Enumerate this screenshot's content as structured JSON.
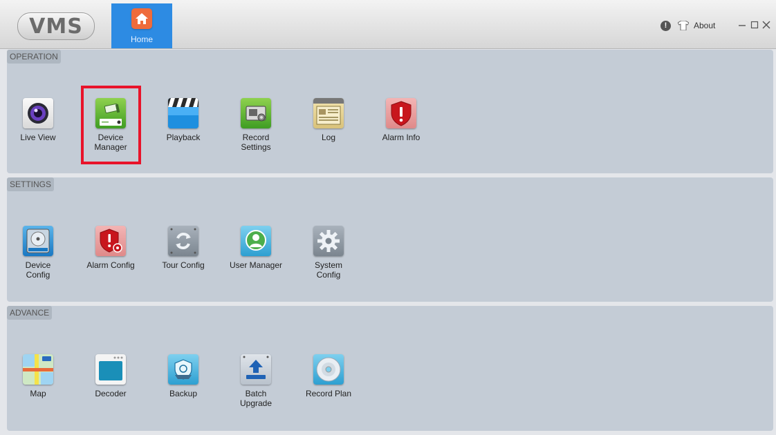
{
  "app": {
    "logo_text": "VMS",
    "home_tab_label": "Home",
    "about_label": "About",
    "window_controls": [
      "minimize",
      "maximize",
      "close"
    ]
  },
  "sections": {
    "operation": {
      "title": "OPERATION",
      "items": [
        {
          "label": "Live View",
          "icon": "camera-lens-icon"
        },
        {
          "label": "Device\nManager",
          "icon": "camera-device-icon"
        },
        {
          "label": "Playback",
          "icon": "clapperboard-icon"
        },
        {
          "label": "Record\nSettings",
          "icon": "record-settings-icon"
        },
        {
          "label": "Log",
          "icon": "log-icon"
        },
        {
          "label": "Alarm Info",
          "icon": "alarm-shield-icon"
        }
      ]
    },
    "settings": {
      "title": "SETTINGS",
      "items": [
        {
          "label": "Device\nConfig",
          "icon": "hard-disk-icon"
        },
        {
          "label": "Alarm Config",
          "icon": "alarm-config-icon"
        },
        {
          "label": "Tour Config",
          "icon": "tour-refresh-icon"
        },
        {
          "label": "User Manager",
          "icon": "user-icon"
        },
        {
          "label": "System\nConfig",
          "icon": "gear-icon"
        }
      ]
    },
    "advance": {
      "title": "ADVANCE",
      "items": [
        {
          "label": "Map",
          "icon": "map-icon"
        },
        {
          "label": "Decoder",
          "icon": "decoder-icon"
        },
        {
          "label": "Backup",
          "icon": "backup-icon"
        },
        {
          "label": "Batch\nUpgrade",
          "icon": "upload-icon"
        },
        {
          "label": "Record Plan",
          "icon": "disc-icon"
        }
      ]
    }
  },
  "colors": {
    "accent_tab": "#2d8be3",
    "highlight_border": "#e8132a",
    "section_bg": "#c4ccd6"
  }
}
